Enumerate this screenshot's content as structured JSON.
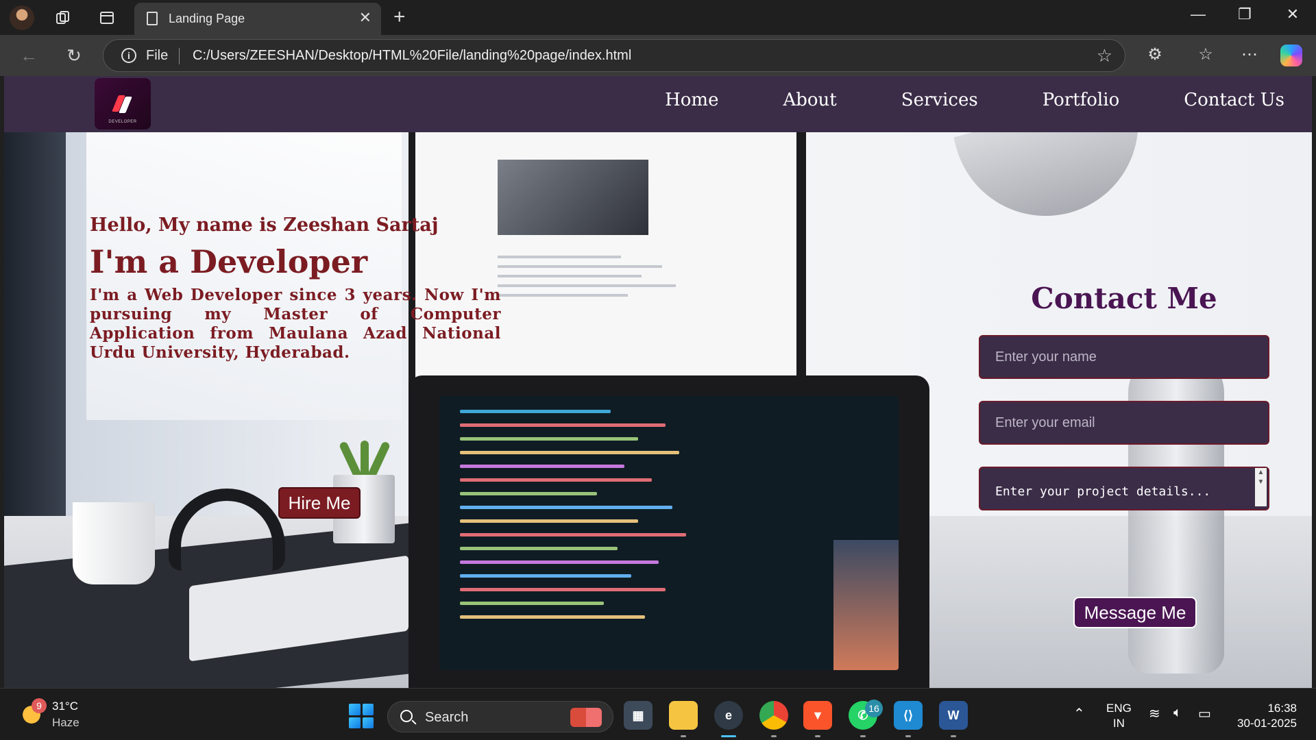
{
  "browser": {
    "tab_title": "Landing Page",
    "address_scheme": "File",
    "url": "C:/Users/ZEESHAN/Desktop/HTML%20File/landing%20page/index.html"
  },
  "site": {
    "logo_text": "DEVELOPER",
    "nav": [
      "Home",
      "About",
      "Services",
      "Portfolio",
      "Contact Us"
    ],
    "hero": {
      "greeting": "Hello, My name is Zeeshan Sartaj",
      "headline": "I'm a Developer",
      "bio": "I'm a Web Developer since 3 years. Now I'm pursuing my Master of Computer Application from Maulana Azad National Urdu University, Hyderabad.",
      "cta_label": "Hire Me"
    },
    "contact": {
      "heading": "Contact Me",
      "name_placeholder": "Enter your name",
      "email_placeholder": "Enter your email",
      "details_placeholder": "Enter your project details...",
      "submit_label": "Message Me"
    }
  },
  "taskbar": {
    "weather_badge": "9",
    "temperature": "31°C",
    "condition": "Haze",
    "search_label": "Search",
    "whatsapp_badge": "16",
    "language_line1": "ENG",
    "language_line2": "IN",
    "time": "16:38",
    "date": "30-01-2025"
  },
  "colors": {
    "header_bg": "#3b2d48",
    "hero_text": "#7b1c22",
    "contact_heading": "#4a1552"
  }
}
